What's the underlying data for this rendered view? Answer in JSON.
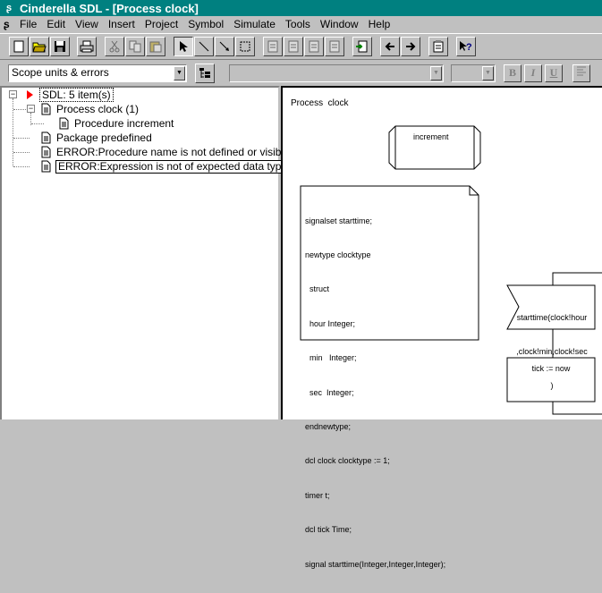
{
  "window": {
    "title": "Cinderella SDL - [Process clock]"
  },
  "menu": [
    "File",
    "Edit",
    "View",
    "Insert",
    "Project",
    "Symbol",
    "Simulate",
    "Tools",
    "Window",
    "Help"
  ],
  "toolbar": {
    "buttons": [
      {
        "name": "new-icon",
        "enabled": true
      },
      {
        "name": "open-folder-icon",
        "enabled": true
      },
      {
        "name": "save-icon",
        "enabled": true
      },
      {
        "name": "print-icon",
        "enabled": true
      },
      {
        "name": "cut-icon",
        "enabled": false
      },
      {
        "name": "copy-icon",
        "enabled": false
      },
      {
        "name": "paste-icon",
        "enabled": false
      },
      {
        "name": "select-arrow-icon",
        "enabled": true
      },
      {
        "name": "line-icon",
        "enabled": true
      },
      {
        "name": "connector-icon",
        "enabled": true
      },
      {
        "name": "frame-icon",
        "enabled": true
      },
      {
        "name": "symbol-icon",
        "enabled": false
      },
      {
        "name": "back-icon",
        "enabled": true
      },
      {
        "name": "forward-icon",
        "enabled": true
      },
      {
        "name": "properties-icon",
        "enabled": true
      },
      {
        "name": "help-pointer-icon",
        "enabled": true
      }
    ]
  },
  "scope_select": {
    "value": "Scope units & errors"
  },
  "format": {
    "bold": "B",
    "italic": "I",
    "underline": "U"
  },
  "tree": {
    "root": "SDL: 5 item(s)",
    "process": "Process clock (1)",
    "procedure": "Procedure increment",
    "package": "Package predefined",
    "error1": "ERROR:Procedure name is not defined or visible",
    "error2": "ERROR:Expression is not of expected data type clocktype or argument type(s) are"
  },
  "diagram": {
    "header": "Process  clock",
    "procedure_symbol": "increment",
    "text_symbol": [
      "signalset starttime;",
      "newtype clocktype",
      "  struct",
      "  hour Integer;",
      "  min   Integer;",
      "  sec  Integer;",
      "endnewtype;",
      "dcl clock clocktype := 1;",
      "timer t;",
      "dcl tick Time;",
      "signal starttime(Integer,Integer,Integer);"
    ],
    "output_symbol": [
      "starttime(clock!hour",
      ",clock!min,clock!sec",
      ")"
    ],
    "task_symbol": "tick := now"
  },
  "colors": {
    "titlebar": "#008080",
    "selection_arrow": "#ff0000"
  }
}
